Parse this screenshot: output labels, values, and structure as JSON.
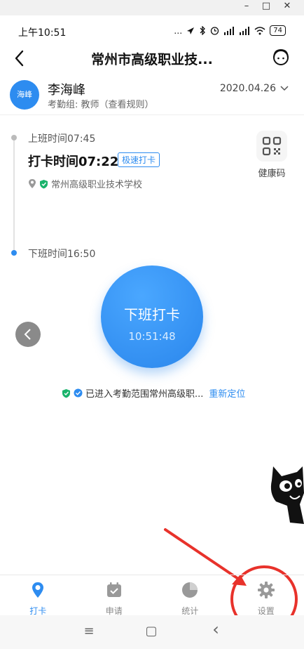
{
  "window": {
    "minimize": "–",
    "maximize": "□",
    "close": "✕"
  },
  "status_bar": {
    "time": "上午10:51",
    "signal": "…",
    "battery": "74"
  },
  "header": {
    "title": "常州市高级职业技...",
    "back_icon": "back-arrow-icon",
    "service_icon": "customer-service-icon"
  },
  "user": {
    "avatar_text": "海峰",
    "name": "李海峰",
    "group_prefix": "考勤组: 教师",
    "rule_link": "（查看规则）",
    "date": "2020.04.26"
  },
  "morning": {
    "label": "上班时间07:45",
    "punch_time": "打卡时间07:22",
    "badge": "极速打卡",
    "location": "常州高级职业技术学校"
  },
  "health_code": {
    "label": "健康码"
  },
  "evening": {
    "label": "下班时间16:50"
  },
  "punch_button": {
    "title": "下班打卡",
    "clock": "10:51:48"
  },
  "range": {
    "text": "已进入考勤范围常州高级职...",
    "relocate": "重新定位"
  },
  "tabs": [
    {
      "label": "打卡",
      "icon": "location-pin-icon",
      "active": true
    },
    {
      "label": "申请",
      "icon": "calendar-check-icon",
      "active": false
    },
    {
      "label": "统计",
      "icon": "pie-chart-icon",
      "active": false
    },
    {
      "label": "设置",
      "icon": "gear-icon",
      "active": false
    }
  ],
  "nav": {
    "menu": "≡",
    "home": "▢",
    "back": "‹"
  },
  "colors": {
    "accent": "#2d8cf0",
    "annotation": "#e8322b",
    "shield": "#19b36b"
  }
}
